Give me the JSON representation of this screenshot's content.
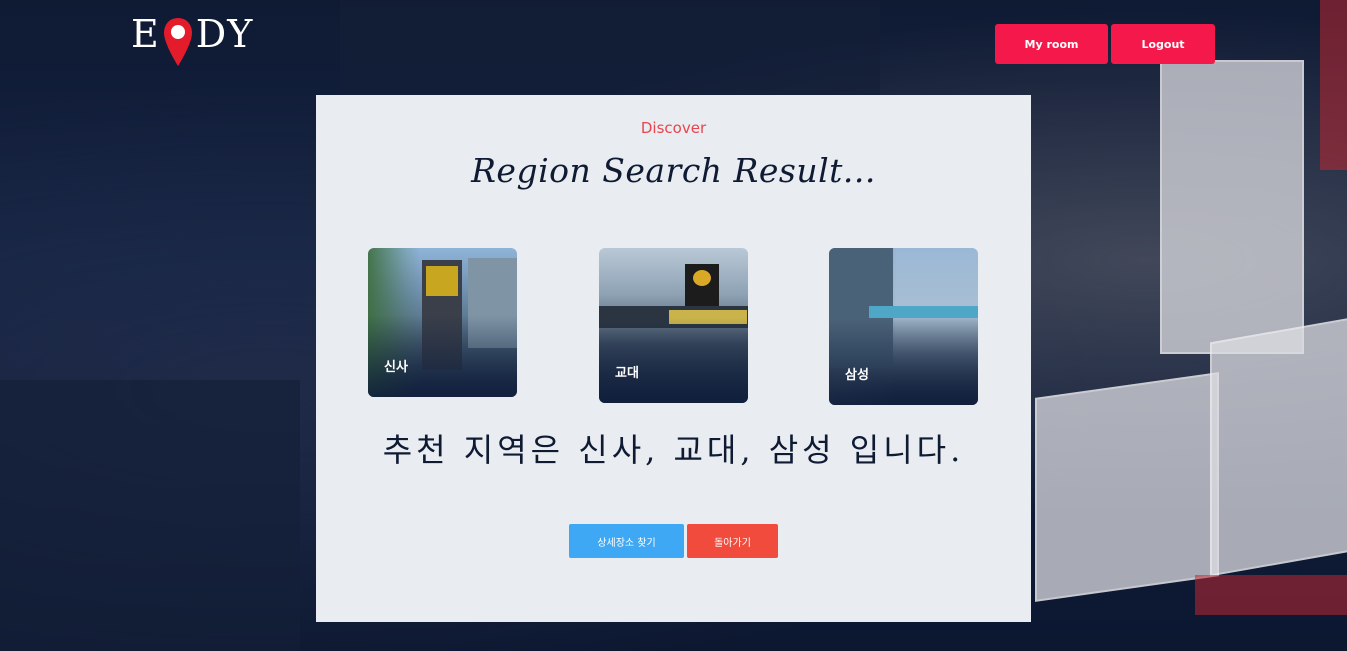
{
  "header": {
    "logo_left": "E",
    "logo_right": "DY",
    "myroom_label": "My room",
    "logout_label": "Logout"
  },
  "main": {
    "eyebrow": "Discover",
    "title": "Region Search Result...",
    "regions": [
      {
        "name": "신사"
      },
      {
        "name": "교대"
      },
      {
        "name": "삼성"
      }
    ],
    "recommendation": "추천 지역은 신사, 교대, 삼성 입니다.",
    "detail_button": "상세장소 찾기",
    "back_button": "돌아가기"
  },
  "colors": {
    "accent_red": "#f5184a",
    "discover_red": "#e8454f",
    "blue_button": "#3ea8f5",
    "back_button": "#f04b3d",
    "card_bg": "#e9ecf0",
    "navy_text": "#0e1b33"
  }
}
